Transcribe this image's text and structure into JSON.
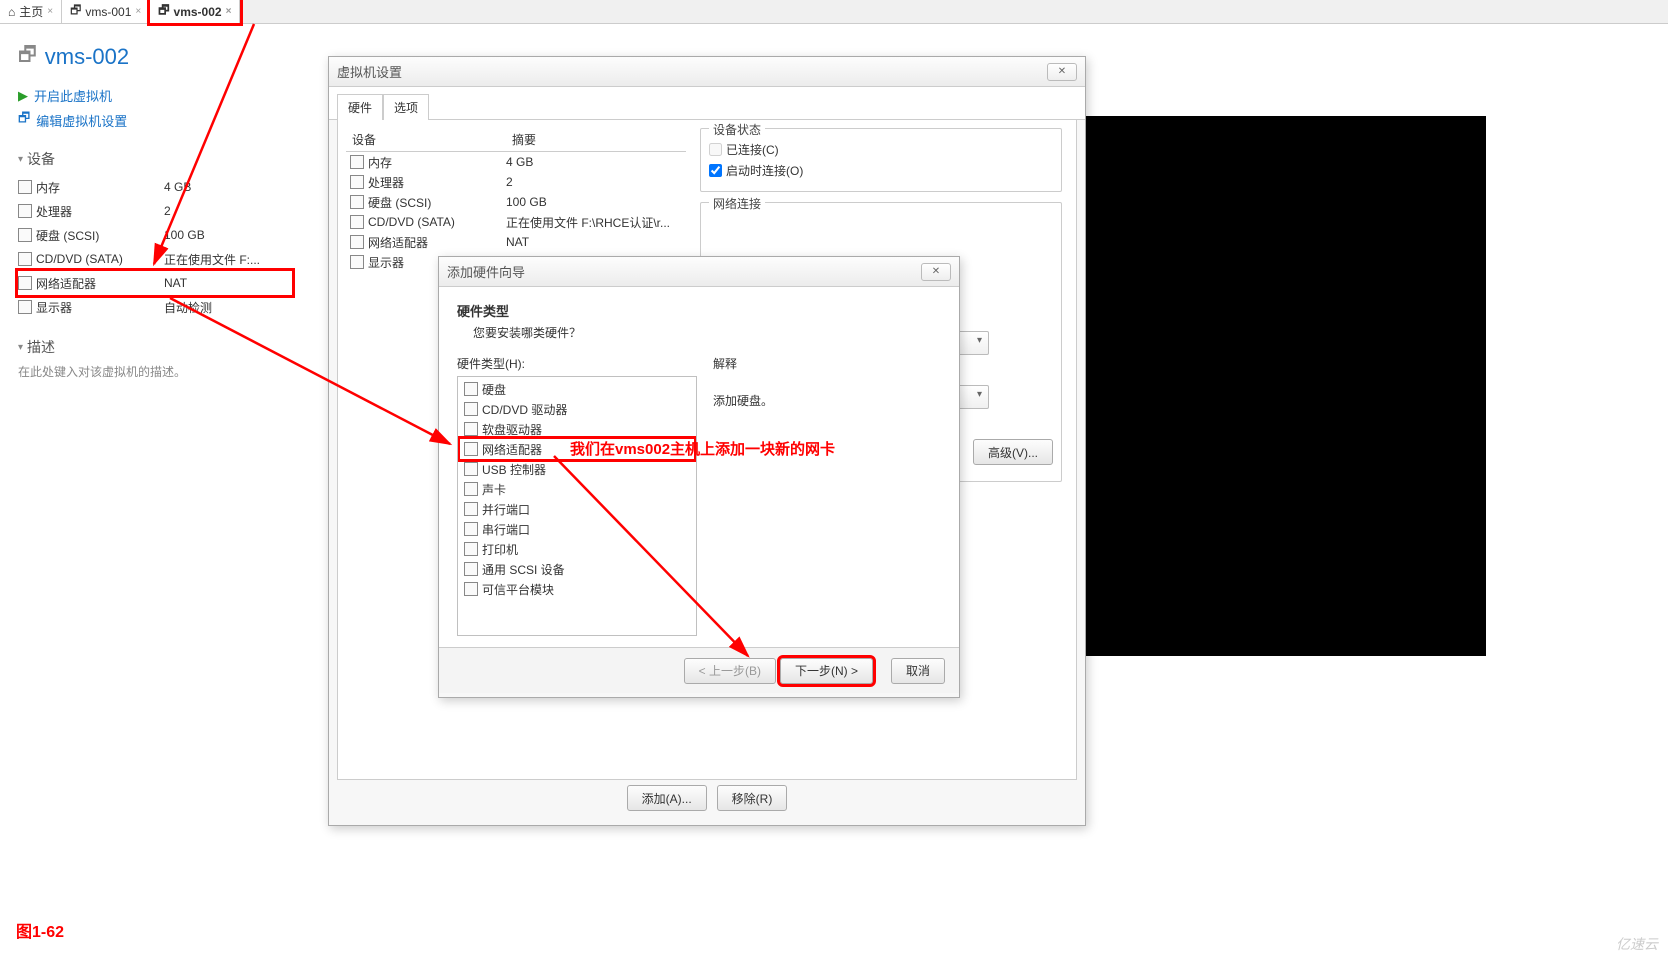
{
  "tabs": [
    {
      "label": "主页",
      "icon": "home-icon"
    },
    {
      "label": "vms-001",
      "icon": "vm-icon"
    },
    {
      "label": "vms-002",
      "icon": "vm-icon",
      "active": true
    }
  ],
  "vm": {
    "title": "vms-002",
    "action_power": "开启此虚拟机",
    "action_edit": "编辑虚拟机设置"
  },
  "side": {
    "devices_head": "设备",
    "devices": [
      {
        "name": "内存",
        "value": "4 GB"
      },
      {
        "name": "处理器",
        "value": "2"
      },
      {
        "name": "硬盘 (SCSI)",
        "value": "100 GB"
      },
      {
        "name": "CD/DVD (SATA)",
        "value": "正在使用文件 F:..."
      },
      {
        "name": "网络适配器",
        "value": "NAT"
      },
      {
        "name": "显示器",
        "value": "自动检测"
      }
    ],
    "desc_head": "描述",
    "desc_placeholder": "在此处键入对该虚拟机的描述。"
  },
  "settings": {
    "title": "虚拟机设置",
    "tab_hw": "硬件",
    "tab_opt": "选项",
    "col_device": "设备",
    "col_summary": "摘要",
    "rows": [
      {
        "name": "内存",
        "summary": "4 GB"
      },
      {
        "name": "处理器",
        "summary": "2"
      },
      {
        "name": "硬盘 (SCSI)",
        "summary": "100 GB"
      },
      {
        "name": "CD/DVD (SATA)",
        "summary": "正在使用文件 F:\\RHCE认证\\r..."
      },
      {
        "name": "网络适配器",
        "summary": "NAT"
      },
      {
        "name": "显示器",
        "summary": ""
      }
    ],
    "status_head": "设备状态",
    "chk_connected": "已连接(C)",
    "chk_connect_poweron": "启动时连接(O)",
    "net_head": "网络连接",
    "advanced_btn": "高级(V)...",
    "add_btn": "添加(A)...",
    "remove_btn": "移除(R)"
  },
  "wizard": {
    "title": "添加硬件向导",
    "head": "硬件类型",
    "sub": "您要安装哪类硬件？",
    "list_label": "硬件类型(H):",
    "explain_label": "解释",
    "explain_text": "添加硬盘。",
    "items": [
      "硬盘",
      "CD/DVD 驱动器",
      "软盘驱动器",
      "网络适配器",
      "USB 控制器",
      "声卡",
      "并行端口",
      "串行端口",
      "打印机",
      "通用 SCSI 设备",
      "可信平台模块"
    ],
    "prev_btn": "< 上一步(B)",
    "next_btn": "下一步(N) >",
    "cancel_btn": "取消"
  },
  "annotation": "我们在vms002主机上添加一块新的网卡",
  "figure_label": "图1-62",
  "watermark": "亿速云"
}
